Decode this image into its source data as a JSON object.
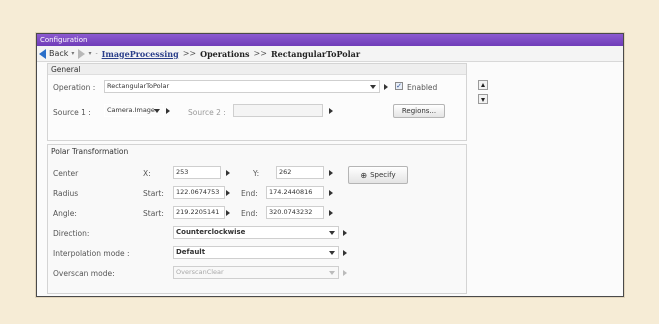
{
  "window": {
    "title": "Configuration"
  },
  "nav": {
    "back_label": "Back",
    "drop_glyph": "▾",
    "sep": "-",
    "crumbs": {
      "root": "ImageProcessing",
      "mid": "Operations",
      "leaf": "RectangularToPolar",
      "separator": ">>"
    }
  },
  "general": {
    "header": "General",
    "operation_label": "Operation :",
    "operation_value": "RectangularToPolar",
    "enabled_label": "Enabled",
    "enabled_checked": true,
    "check_glyph": "✓",
    "source1_label": "Source 1 :",
    "source1_value": "Camera.Image",
    "source2_label": "Source 2 :",
    "source2_value": "",
    "regions_button": "Regions..."
  },
  "polar": {
    "header": "Polar Transformation",
    "center_label": "Center",
    "x_label": "X:",
    "x_value": "253",
    "y_label": "Y:",
    "y_value": "262",
    "specify_button": "Specify",
    "radius_label": "Radius",
    "start_label": "Start:",
    "end_label": "End:",
    "radius_start": "122.0674753",
    "radius_end": "174.2440816",
    "angle_label": "Angle:",
    "angle_start": "219.2205141",
    "angle_end": "320.0743232",
    "direction_label": "Direction:",
    "direction_value": "Counterclockwise",
    "interp_label": "Interpolation mode :",
    "interp_value": "Default",
    "overscan_label": "Overscan mode:",
    "overscan_value": "OverscanClear"
  },
  "colors": {
    "titlebar": "#7a46c4",
    "link": "#2b3f8a",
    "accent": "#2a6fc9"
  }
}
